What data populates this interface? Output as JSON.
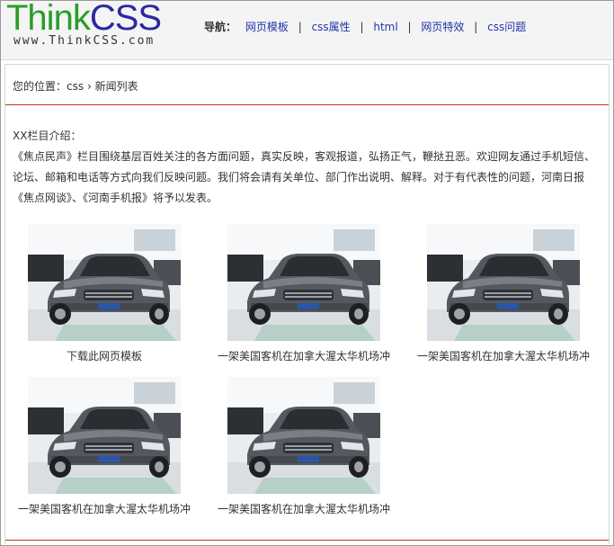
{
  "logo": {
    "think": "Think",
    "css": "CSS",
    "subtitle": "www.ThinkCSS.com"
  },
  "nav": {
    "label": "导航：",
    "items": [
      "网页模板",
      "css属性",
      "html",
      "网页特效",
      "css问题"
    ],
    "separator": "|"
  },
  "breadcrumb": {
    "prefix": "您的位置：",
    "section": "css",
    "arrow": "›",
    "current": "新闻列表"
  },
  "intro": {
    "title": "XX栏目介绍：",
    "body": "《焦点民声》栏目围绕基层百姓关注的各方面问题，真实反映，客观报道，弘扬正气，鞭挞丑恶。欢迎网友通过手机短信、论坛、邮箱和电话等方式向我们反映问题。我们将会请有关单位、部门作出说明、解释。对于有代表性的问题，河南日报《焦点网谈》、《河南手机报》将予以发表。"
  },
  "gallery": {
    "items": [
      {
        "caption": "下载此网页模板",
        "image": "silver-sedan-showroom-photo"
      },
      {
        "caption": "一架美国客机在加拿大渥太华机场冲",
        "image": "silver-sedan-showroom-photo"
      },
      {
        "caption": "一架美国客机在加拿大渥太华机场冲",
        "image": "silver-sedan-showroom-photo"
      },
      {
        "caption": "一架美国客机在加拿大渥太华机场冲",
        "image": "silver-sedan-showroom-photo"
      },
      {
        "caption": "一架美国客机在加拿大渥太华机场冲",
        "image": "silver-sedan-showroom-photo"
      }
    ]
  },
  "colors": {
    "logo_think": "#2a9d2a",
    "logo_css": "#2a2aa0",
    "link": "#2233aa",
    "rule": "#c9302c"
  }
}
